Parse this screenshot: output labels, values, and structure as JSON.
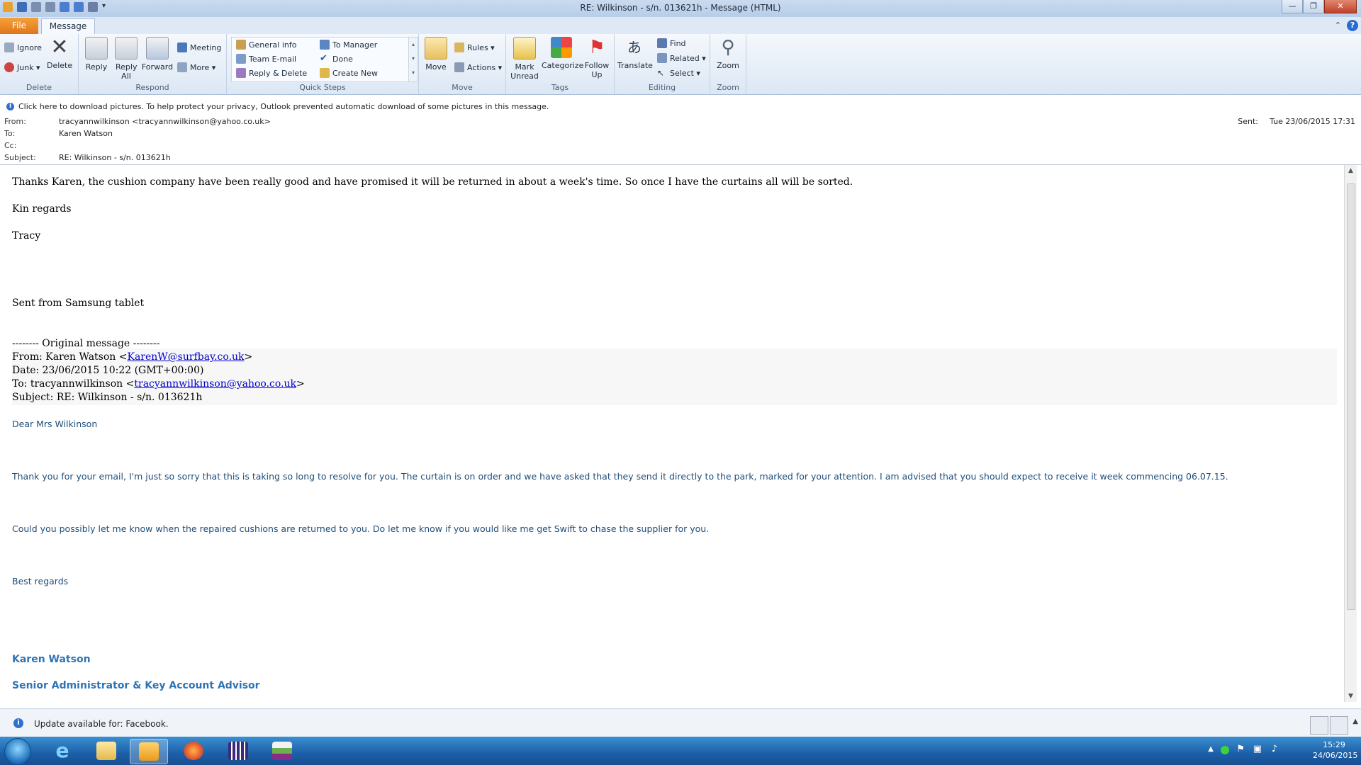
{
  "window": {
    "title": "RE: Wilkinson - s/n. 013621h  -  Message (HTML)",
    "minimize": "—",
    "maximize": "❐",
    "close": "✕"
  },
  "tabs": {
    "file": "File",
    "message": "Message",
    "help": "?"
  },
  "ribbon": {
    "delete_group": {
      "label": "Delete",
      "ignore": "Ignore",
      "junk": "Junk ▾",
      "delete": "Delete"
    },
    "respond_group": {
      "label": "Respond",
      "reply": "Reply",
      "reply_all": "Reply All",
      "forward": "Forward",
      "meeting": "Meeting",
      "more": "More ▾"
    },
    "quick_steps": {
      "label": "Quick Steps",
      "items": [
        "General info",
        "To Manager",
        "Team E-mail",
        "Done",
        "Reply & Delete",
        "Create New"
      ]
    },
    "move_group": {
      "label": "Move",
      "move": "Move",
      "rules": "Rules ▾",
      "actions": "Actions ▾"
    },
    "tags_group": {
      "label": "Tags",
      "mark_unread": "Mark Unread",
      "categorize": "Categorize",
      "follow_up": "Follow Up"
    },
    "editing_group": {
      "label": "Editing",
      "translate": "Translate",
      "find": "Find",
      "related": "Related ▾",
      "select": "Select ▾"
    },
    "zoom_group": {
      "label": "Zoom",
      "zoom": "Zoom"
    }
  },
  "infobar": "Click here to download pictures. To help protect your privacy, Outlook prevented automatic download of some pictures in this message.",
  "header": {
    "from_label": "From:",
    "from": "tracyannwilkinson <tracyannwilkinson@yahoo.co.uk>",
    "to_label": "To:",
    "to": "Karen Watson",
    "cc_label": "Cc:",
    "cc": "",
    "subject_label": "Subject:",
    "subject": "RE: Wilkinson - s/n. 013621h",
    "sent_label": "Sent:",
    "sent": "Tue 23/06/2015 17:31"
  },
  "body": {
    "line1": "Thanks Karen, the cushion company have been really good and have promised it will be returned in about a week's time. So once I have the curtains all will be sorted.",
    "line2": "Kin regards",
    "line3": "Tracy",
    "line4": "Sent from Samsung tablet",
    "orig_sep": "-------- Original message --------",
    "orig_from_prefix": "From: Karen Watson <",
    "orig_from_email": "KarenW@surfbay.co.uk",
    "orig_from_suffix": ">",
    "orig_date": "Date: 23/06/2015 10:22 (GMT+00:00)",
    "orig_to_prefix": "To: tracyannwilkinson <",
    "orig_to_email": "tracyannwilkinson@yahoo.co.uk",
    "orig_to_suffix": ">",
    "orig_subject": "Subject: RE: Wilkinson - s/n. 013621h",
    "dear": "Dear Mrs Wilkinson",
    "para1": "Thank you for your email, I'm just so sorry that this is taking so long to resolve for you. The curtain is on order and we have asked that they send it directly to the park, marked for your attention.  I am advised that you should expect to receive it week commencing 06.07.15.",
    "para2": "Could you possibly let me know when the repaired cushions are returned to you. Do let me know if you would like me get Swift to chase the supplier for you.",
    "best": "Best regards",
    "sig_name": "Karen Watson",
    "sig_title": "Senior Administrator & Key Account Advisor"
  },
  "people_bar": {
    "text": "Update available for: Facebook."
  },
  "taskbar": {
    "apps": [
      "internet-explorer",
      "file-explorer",
      "outlook",
      "firefox",
      "calculator-app",
      "sage"
    ],
    "time": "15:29",
    "date": "24/06/2015"
  },
  "colors": {
    "accent": "#2e74b5",
    "body_blue": "#1f4e79",
    "file_tab": "#e0751a",
    "taskbar": "#1c5fa8"
  }
}
